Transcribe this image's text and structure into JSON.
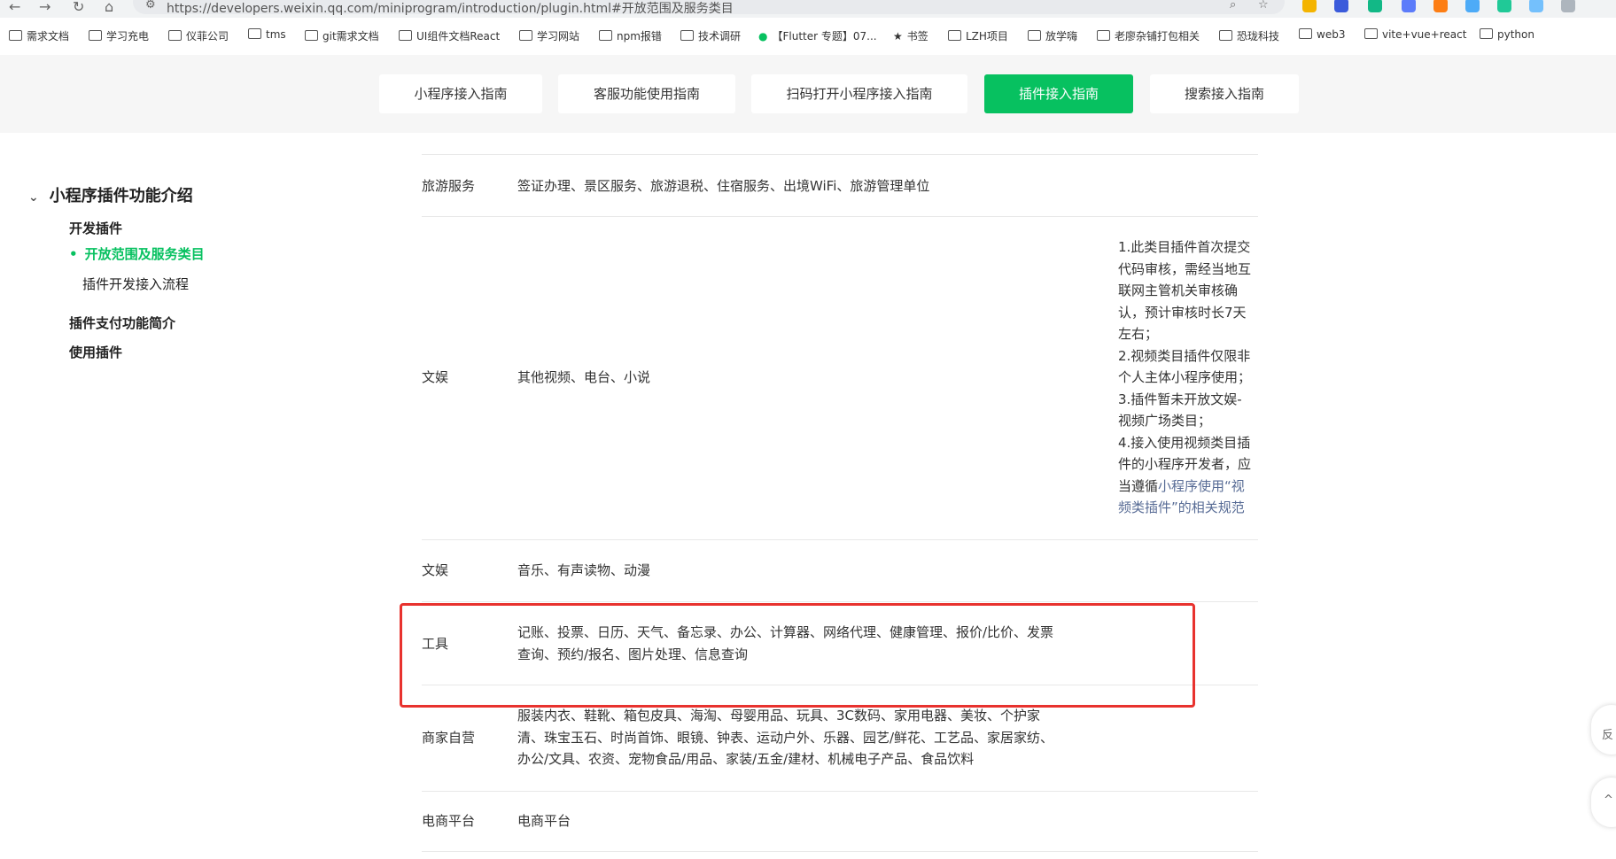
{
  "browser": {
    "url": "https://developers.weixin.qq.com/miniprogram/introduction/plugin.html#开放范围及服务类目",
    "bookmarks": [
      "需求文档",
      "学习充电",
      "仪菲公司",
      "tms",
      "git需求文档",
      "UI组件文档React",
      "学习网站",
      "npm报错",
      "技术调研",
      "【Flutter 专题】07...",
      "书签",
      "LZH项目",
      "放学嗨",
      "老廖杂铺打包相关",
      "恐珑科技",
      "web3",
      "vite+vue+react",
      "python"
    ]
  },
  "tabs": [
    {
      "label": "小程序接入指南",
      "active": false
    },
    {
      "label": "客服功能使用指南",
      "active": false
    },
    {
      "label": "扫码打开小程序接入指南",
      "active": false
    },
    {
      "label": "插件接入指南",
      "active": true
    },
    {
      "label": "搜索接入指南",
      "active": false
    }
  ],
  "sidebar": {
    "section_title": "小程序插件功能介绍",
    "items": [
      {
        "label": "开发插件"
      },
      {
        "label": "开放范围及服务类目"
      },
      {
        "label": "插件开发接入流程"
      },
      {
        "label": "插件支付功能简介"
      },
      {
        "label": "使用插件"
      }
    ]
  },
  "table": {
    "rows": [
      {
        "category": "旅游服务",
        "services": "签证办理、景区服务、旅游退税、住宿服务、出境WiFi、旅游管理单位",
        "note": ""
      },
      {
        "category": "文娱",
        "services": "其他视频、电台、小说",
        "note_lines": [
          "1.此类目插件首次提交",
          "代码审核，需经当地互",
          "联网主管机关审核确",
          "认，预计审核时长7天",
          "左右；",
          "2.视频类目插件仅限非",
          "个人主体小程序使用；",
          "3.插件暂未开放文娱-",
          "视频广场类目；",
          "4.接入使用视频类目插",
          "件的小程序开发者，应",
          "当遵循"
        ],
        "note_link_a": "小程序使用“视",
        "note_link_b": "频类插件”的相关规范"
      },
      {
        "category": "文娱",
        "services": "音乐、有声读物、动漫",
        "note": ""
      },
      {
        "category": "工具",
        "services_l1": "记账、投票、日历、天气、备忘录、办公、计算器、网络代理、健康管理、报价/比价、发票",
        "services_l2": "查询、预约/报名、图片处理、信息查询",
        "note": ""
      },
      {
        "category": "商家自营",
        "services_l1": "服装内衣、鞋靴、箱包皮具、海淘、母婴用品、玩具、3C数码、家用电器、美妆、个护家",
        "services_l2": "清、珠宝玉石、时尚首饰、眼镜、钟表、运动户外、乐器、园艺/鲜花、工艺品、家居家纺、",
        "services_l3": "办公/文具、农资、宠物食品/用品、家装/五金/建材、机械电子产品、食品饮料",
        "note": ""
      },
      {
        "category": "电商平台",
        "services": "电商平台",
        "note": ""
      }
    ]
  },
  "float": {
    "feedback_char": "反",
    "top_char": "^"
  },
  "colors": {
    "accent": "#07c160",
    "highlight": "#e8322e",
    "link": "#576b95"
  }
}
